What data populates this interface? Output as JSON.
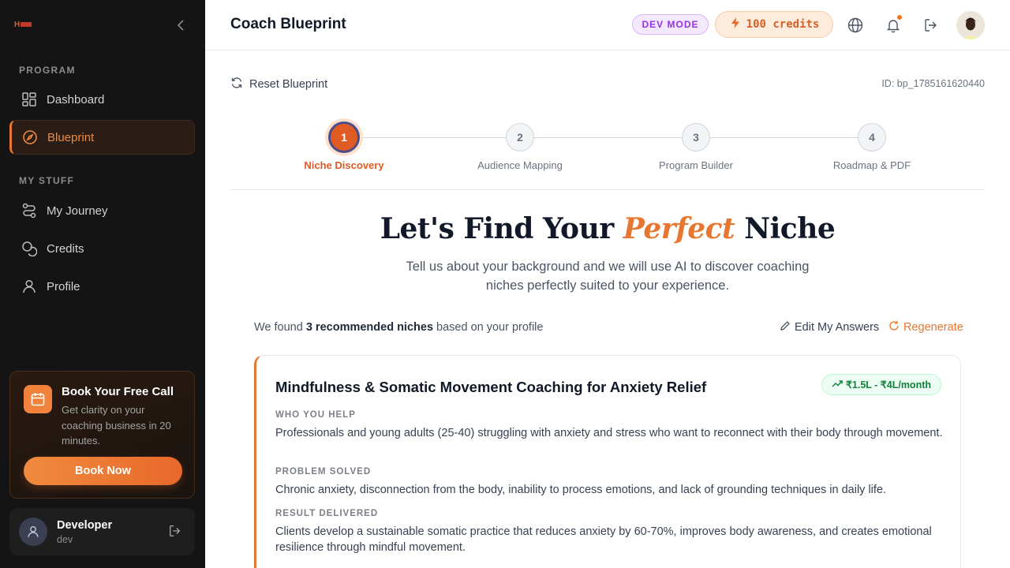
{
  "sidebar": {
    "logo_text": "H",
    "sections": [
      {
        "label": "PROGRAM"
      },
      {
        "label": "MY STUFF"
      }
    ],
    "items": [
      {
        "label": "Dashboard",
        "icon": "grid-icon"
      },
      {
        "label": "Blueprint",
        "icon": "compass-icon",
        "active": true
      },
      {
        "label": "My Journey",
        "icon": "route-icon"
      },
      {
        "label": "Credits",
        "icon": "coins-icon"
      },
      {
        "label": "Profile",
        "icon": "user-icon"
      }
    ],
    "promo": {
      "title": "Book Your Free Call",
      "description": "Get clarity on your coaching business in 20 minutes.",
      "button": "Book Now"
    },
    "user": {
      "name": "Developer",
      "handle": "dev"
    }
  },
  "header": {
    "title": "Coach Blueprint",
    "dev_badge": "DEV MODE",
    "credits": "100 credits",
    "accent": "#e8762f"
  },
  "main": {
    "reset_label": "Reset Blueprint",
    "blueprint_id": "ID: bp_1785161620440",
    "steps": [
      {
        "number": "1",
        "label": "Niche Discovery",
        "active": true
      },
      {
        "number": "2",
        "label": "Audience Mapping"
      },
      {
        "number": "3",
        "label": "Program Builder"
      },
      {
        "number": "4",
        "label": "Roadmap & PDF"
      }
    ],
    "hero": {
      "title_before": "Let's Find Your ",
      "title_emphasis": "Perfect",
      "title_after": " Niche",
      "subtitle": "Tell us about your background and we will use AI to discover coaching niches perfectly suited to your experience."
    },
    "found": {
      "prefix": "We found ",
      "highlight": "3 recommended niches",
      "suffix": " based on your profile"
    },
    "edit_label": "Edit My Answers",
    "regenerate_label": "Regenerate",
    "niche_card": {
      "title": "Mindfulness & Somatic Movement Coaching for Anxiety Relief",
      "income": "₹1.5L - ₹4L/month",
      "who_label": "WHO YOU HELP",
      "who_text": "Professionals and young adults (25-40) struggling with anxiety and stress who want to reconnect with their body through movement.",
      "problem_label": "PROBLEM SOLVED",
      "problem_text": "Chronic anxiety, disconnection from the body, inability to process emotions, and lack of grounding techniques in daily life.",
      "result_label": "RESULT DELIVERED",
      "result_text": "Clients develop a sustainable somatic practice that reduces anxiety by 60-70%, improves body awareness, and creates emotional resilience through mindful movement."
    }
  }
}
